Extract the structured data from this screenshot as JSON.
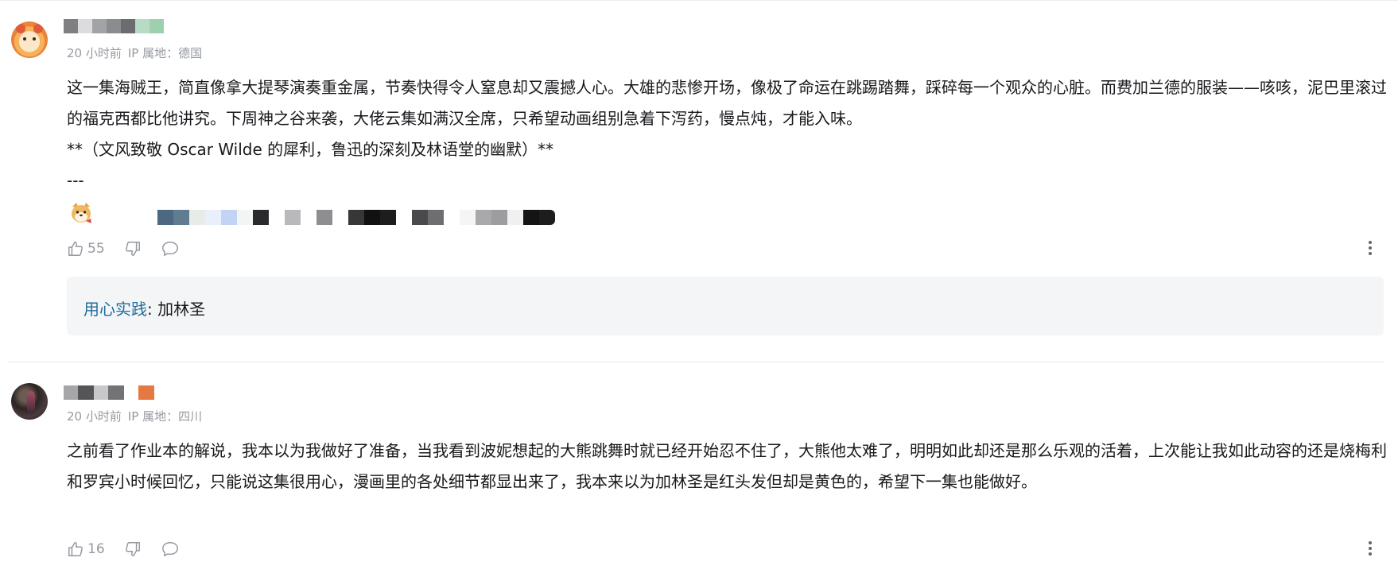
{
  "comments": [
    {
      "avatar_icon": "cartoon-lion-avatar",
      "username_redacted_colors": [
        "#7f7f82",
        "#dcdcde",
        "#a2a3a6",
        "#8b8c8f",
        "#6b6c6f",
        "#b7dbc4",
        "#9ed0b0"
      ],
      "time": "20 小时前",
      "ip": "IP 属地：德国",
      "paragraphs": [
        "这一集海贼王，简直像拿大提琴演奏重金属，节奏快得令人窒息却又震撼人心。大雄的悲惨开场，像极了命运在跳踢踏舞，踩碎每一个观众的心脏。而费加兰德的服装——咳咳，泥巴里滚过的福克西都比他讲究。下周神之谷来袭，大佬云集如满汉全席，只希望动画组别急着下泻药，慢点炖，才能入味。",
        "**（文风致敬 Oscar Wilde 的犀利，鲁迅的深刻及林语堂的幽默）**",
        "---"
      ],
      "signature_sticker_icon": "shiba-sticker-icon",
      "signature_redacted_colors": [
        "#4d6982",
        "#5f7c90",
        "#e7ece8",
        "#e7f0fb",
        "#c3d3f3",
        "#f3f4f4",
        "#2a2a2c",
        "#b9b9bb",
        "#8e8e90",
        "#373737",
        "#111111",
        "#4a4a4c",
        "#6e6e70",
        "#f5f5f5",
        "#a9a9ab",
        "#9d9d9f",
        "#141414",
        "#1d1d1d"
      ],
      "likes": "55",
      "reply": {
        "tag": "用心实践",
        "separator": ": ",
        "text": "加林圣"
      }
    },
    {
      "avatar_icon": "dark-photo-avatar",
      "username_redacted_colors": [
        "#a6a6a8",
        "#555557",
        "#c8c8ca",
        "#737375",
        "#f4a06a",
        "#e67843"
      ],
      "time": "20 小时前",
      "ip": "IP 属地：四川",
      "paragraphs": [
        "之前看了作业本的解说，我本以为我做好了准备，当我看到波妮想起的大熊跳舞时就已经开始忍不住了，大熊他太难了，明明如此却还是那么乐观的活着，上次能让我如此动容的还是烧梅利和罗宾小时候回忆，只能说这集很用心，漫画里的各处细节都显出来了，我本来以为加林圣是红头发但却是黄色的，希望下一集也能做好。"
      ],
      "likes": "16"
    }
  ],
  "colors": {
    "text": "#18191c",
    "meta": "#9499a0",
    "reply_bg": "#f4f5f7",
    "reply_tag": "#1e6d9a",
    "divider": "#e3e5e7"
  }
}
